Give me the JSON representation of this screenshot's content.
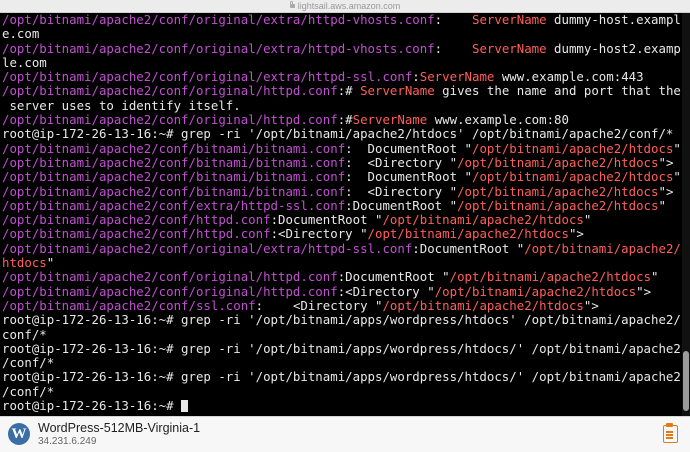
{
  "browser": {
    "url": "lightsail.aws.amazon.com"
  },
  "terminal": {
    "lines": [
      {
        "segs": [
          {
            "c": "p",
            "t": "/opt/bitnami/apache2/conf/original/extra/httpd-vhosts.conf"
          },
          {
            "c": "w",
            "t": ":    "
          },
          {
            "c": "r",
            "t": "ServerName"
          },
          {
            "c": "w",
            "t": " dummy-host.exampl"
          }
        ]
      },
      {
        "segs": [
          {
            "c": "w",
            "t": "e.com"
          }
        ]
      },
      {
        "segs": [
          {
            "c": "p",
            "t": "/opt/bitnami/apache2/conf/original/extra/httpd-vhosts.conf"
          },
          {
            "c": "w",
            "t": ":    "
          },
          {
            "c": "r",
            "t": "ServerName"
          },
          {
            "c": "w",
            "t": " dummy-host2.examp"
          }
        ]
      },
      {
        "segs": [
          {
            "c": "w",
            "t": "le.com"
          }
        ]
      },
      {
        "segs": [
          {
            "c": "p",
            "t": "/opt/bitnami/apache2/conf/original/extra/httpd-ssl.conf"
          },
          {
            "c": "w",
            "t": ":"
          },
          {
            "c": "r",
            "t": "ServerName"
          },
          {
            "c": "w",
            "t": " www.example.com:443"
          }
        ]
      },
      {
        "segs": [
          {
            "c": "p",
            "t": "/opt/bitnami/apache2/conf/original/httpd.conf"
          },
          {
            "c": "w",
            "t": ":# "
          },
          {
            "c": "r",
            "t": "ServerName"
          },
          {
            "c": "w",
            "t": " gives the name and port that the"
          }
        ]
      },
      {
        "segs": [
          {
            "c": "w",
            "t": " server uses to identify itself."
          }
        ]
      },
      {
        "segs": [
          {
            "c": "p",
            "t": "/opt/bitnami/apache2/conf/original/httpd.conf"
          },
          {
            "c": "w",
            "t": ":#"
          },
          {
            "c": "r",
            "t": "ServerName"
          },
          {
            "c": "w",
            "t": " www.example.com:80"
          }
        ]
      },
      {
        "segs": [
          {
            "c": "w",
            "t": "root@ip-172-26-13-16:~# grep -ri '/opt/bitnami/apache2/htdocs' /opt/bitnami/apache2/conf/*"
          }
        ]
      },
      {
        "segs": [
          {
            "c": "p",
            "t": "/opt/bitnami/apache2/conf/bitnami/bitnami.conf"
          },
          {
            "c": "w",
            "t": ":  DocumentRoot \""
          },
          {
            "c": "r",
            "t": "/opt/bitnami/apache2/htdocs"
          },
          {
            "c": "w",
            "t": "\""
          }
        ]
      },
      {
        "segs": [
          {
            "c": "p",
            "t": "/opt/bitnami/apache2/conf/bitnami/bitnami.conf"
          },
          {
            "c": "w",
            "t": ":  <Directory \""
          },
          {
            "c": "r",
            "t": "/opt/bitnami/apache2/htdocs"
          },
          {
            "c": "w",
            "t": "\">"
          }
        ]
      },
      {
        "segs": [
          {
            "c": "p",
            "t": "/opt/bitnami/apache2/conf/bitnami/bitnami.conf"
          },
          {
            "c": "w",
            "t": ":  DocumentRoot \""
          },
          {
            "c": "r",
            "t": "/opt/bitnami/apache2/htdocs"
          },
          {
            "c": "w",
            "t": "\""
          }
        ]
      },
      {
        "segs": [
          {
            "c": "p",
            "t": "/opt/bitnami/apache2/conf/bitnami/bitnami.conf"
          },
          {
            "c": "w",
            "t": ":  <Directory \""
          },
          {
            "c": "r",
            "t": "/opt/bitnami/apache2/htdocs"
          },
          {
            "c": "w",
            "t": "\">"
          }
        ]
      },
      {
        "segs": [
          {
            "c": "p",
            "t": "/opt/bitnami/apache2/conf/extra/httpd-ssl.conf"
          },
          {
            "c": "w",
            "t": ":DocumentRoot \""
          },
          {
            "c": "r",
            "t": "/opt/bitnami/apache2/htdocs"
          },
          {
            "c": "w",
            "t": "\""
          }
        ]
      },
      {
        "segs": [
          {
            "c": "p",
            "t": "/opt/bitnami/apache2/conf/httpd.conf"
          },
          {
            "c": "w",
            "t": ":DocumentRoot \""
          },
          {
            "c": "r",
            "t": "/opt/bitnami/apache2/htdocs"
          },
          {
            "c": "w",
            "t": "\""
          }
        ]
      },
      {
        "segs": [
          {
            "c": "p",
            "t": "/opt/bitnami/apache2/conf/httpd.conf"
          },
          {
            "c": "w",
            "t": ":<Directory \""
          },
          {
            "c": "r",
            "t": "/opt/bitnami/apache2/htdocs"
          },
          {
            "c": "w",
            "t": "\">"
          }
        ]
      },
      {
        "segs": [
          {
            "c": "p",
            "t": "/opt/bitnami/apache2/conf/original/extra/httpd-ssl.conf"
          },
          {
            "c": "w",
            "t": ":DocumentRoot \""
          },
          {
            "c": "r",
            "t": "/opt/bitnami/apache2/"
          }
        ]
      },
      {
        "segs": [
          {
            "c": "r",
            "t": "htdocs"
          },
          {
            "c": "w",
            "t": "\""
          }
        ]
      },
      {
        "segs": [
          {
            "c": "p",
            "t": "/opt/bitnami/apache2/conf/original/httpd.conf"
          },
          {
            "c": "w",
            "t": ":DocumentRoot \""
          },
          {
            "c": "r",
            "t": "/opt/bitnami/apache2/htdocs"
          },
          {
            "c": "w",
            "t": "\""
          }
        ]
      },
      {
        "segs": [
          {
            "c": "p",
            "t": "/opt/bitnami/apache2/conf/original/httpd.conf"
          },
          {
            "c": "w",
            "t": ":<Directory \""
          },
          {
            "c": "r",
            "t": "/opt/bitnami/apache2/htdocs"
          },
          {
            "c": "w",
            "t": "\">"
          }
        ]
      },
      {
        "segs": [
          {
            "c": "p",
            "t": "/opt/bitnami/apache2/conf/ssl.conf"
          },
          {
            "c": "w",
            "t": ":    <Directory \""
          },
          {
            "c": "r",
            "t": "/opt/bitnami/apache2/htdocs"
          },
          {
            "c": "w",
            "t": "\">"
          }
        ]
      },
      {
        "segs": [
          {
            "c": "w",
            "t": "root@ip-172-26-13-16:~# grep -ri '/opt/bitnami/apps/wordpress/htdocs' /opt/bitnami/apache2/"
          }
        ]
      },
      {
        "segs": [
          {
            "c": "w",
            "t": "conf/*"
          }
        ]
      },
      {
        "segs": [
          {
            "c": "w",
            "t": "root@ip-172-26-13-16:~# grep -ri '/opt/bitnami/apps/wordpress/htdocs/' /opt/bitnami/apache2"
          }
        ]
      },
      {
        "segs": [
          {
            "c": "w",
            "t": "/conf/*"
          }
        ]
      },
      {
        "segs": [
          {
            "c": "w",
            "t": "root@ip-172-26-13-16:~# grep -ri '/opt/bitnami/apps/wordpress/htdocs/' /opt/bitnami/apache2"
          }
        ]
      },
      {
        "segs": [
          {
            "c": "w",
            "t": "/conf/*"
          }
        ]
      },
      {
        "segs": [
          {
            "c": "w",
            "t": "root@ip-172-26-13-16:~# "
          }
        ],
        "cursor": true
      }
    ]
  },
  "footer": {
    "instance_name": "WordPress-512MB-Virginia-1",
    "ip": "34.231.6.249",
    "logo_icon": "wordpress-logo",
    "clipboard_icon": "clipboard-icon"
  },
  "colors": {
    "terminal_bg": "#000000",
    "text": "#e8e8e8",
    "path_purple": "#c14fd1",
    "match_red": "#ff5f5a",
    "clipboard_orange": "#e07b1a"
  }
}
